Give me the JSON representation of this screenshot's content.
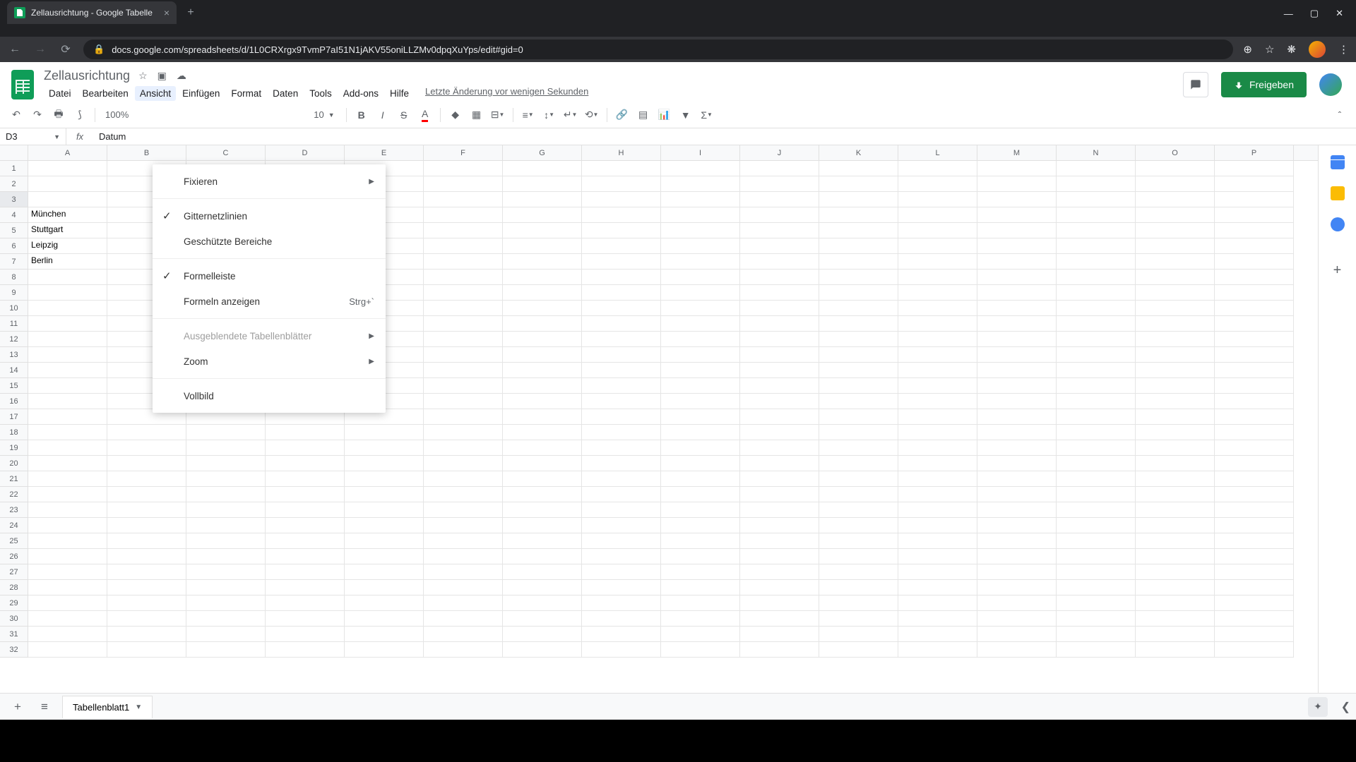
{
  "browser": {
    "tab_title": "Zellausrichtung - Google Tabelle",
    "url": "docs.google.com/spreadsheets/d/1L0CRXrgx9TvmP7aI51N1jAKV55oniLLZMv0dpqXuYps/edit#gid=0"
  },
  "doc": {
    "title": "Zellausrichtung",
    "last_edit": "Letzte Änderung vor wenigen Sekunden",
    "menubar": [
      "Datei",
      "Bearbeiten",
      "Ansicht",
      "Einfügen",
      "Format",
      "Daten",
      "Tools",
      "Add-ons",
      "Hilfe"
    ],
    "active_menu_index": 2,
    "share_label": "Freigeben"
  },
  "toolbar": {
    "zoom": "100%",
    "font_size": "10"
  },
  "formula_bar": {
    "cell_ref": "D3",
    "value": "Datum"
  },
  "columns": [
    "A",
    "B",
    "C",
    "D",
    "E",
    "F",
    "G",
    "H",
    "I",
    "J",
    "K",
    "L",
    "M",
    "N",
    "O",
    "P"
  ],
  "row_count": 32,
  "selected_row": 3,
  "cells": {
    "A4": "München",
    "A5": "Stuttgart",
    "A6": "Leipzig",
    "A7": "Berlin"
  },
  "dropdown": {
    "items": [
      {
        "label": "Fixieren",
        "submenu": true
      },
      {
        "sep": true
      },
      {
        "label": "Gitternetzlinien",
        "checked": true
      },
      {
        "label": "Geschützte Bereiche"
      },
      {
        "sep": true
      },
      {
        "label": "Formelleiste",
        "checked": true
      },
      {
        "label": "Formeln anzeigen",
        "shortcut": "Strg+`"
      },
      {
        "sep": true
      },
      {
        "label": "Ausgeblendete Tabellenblätter",
        "submenu": true,
        "disabled": true
      },
      {
        "label": "Zoom",
        "submenu": true
      },
      {
        "sep": true
      },
      {
        "label": "Vollbild"
      }
    ]
  },
  "sheet_tab": "Tabellenblatt1"
}
